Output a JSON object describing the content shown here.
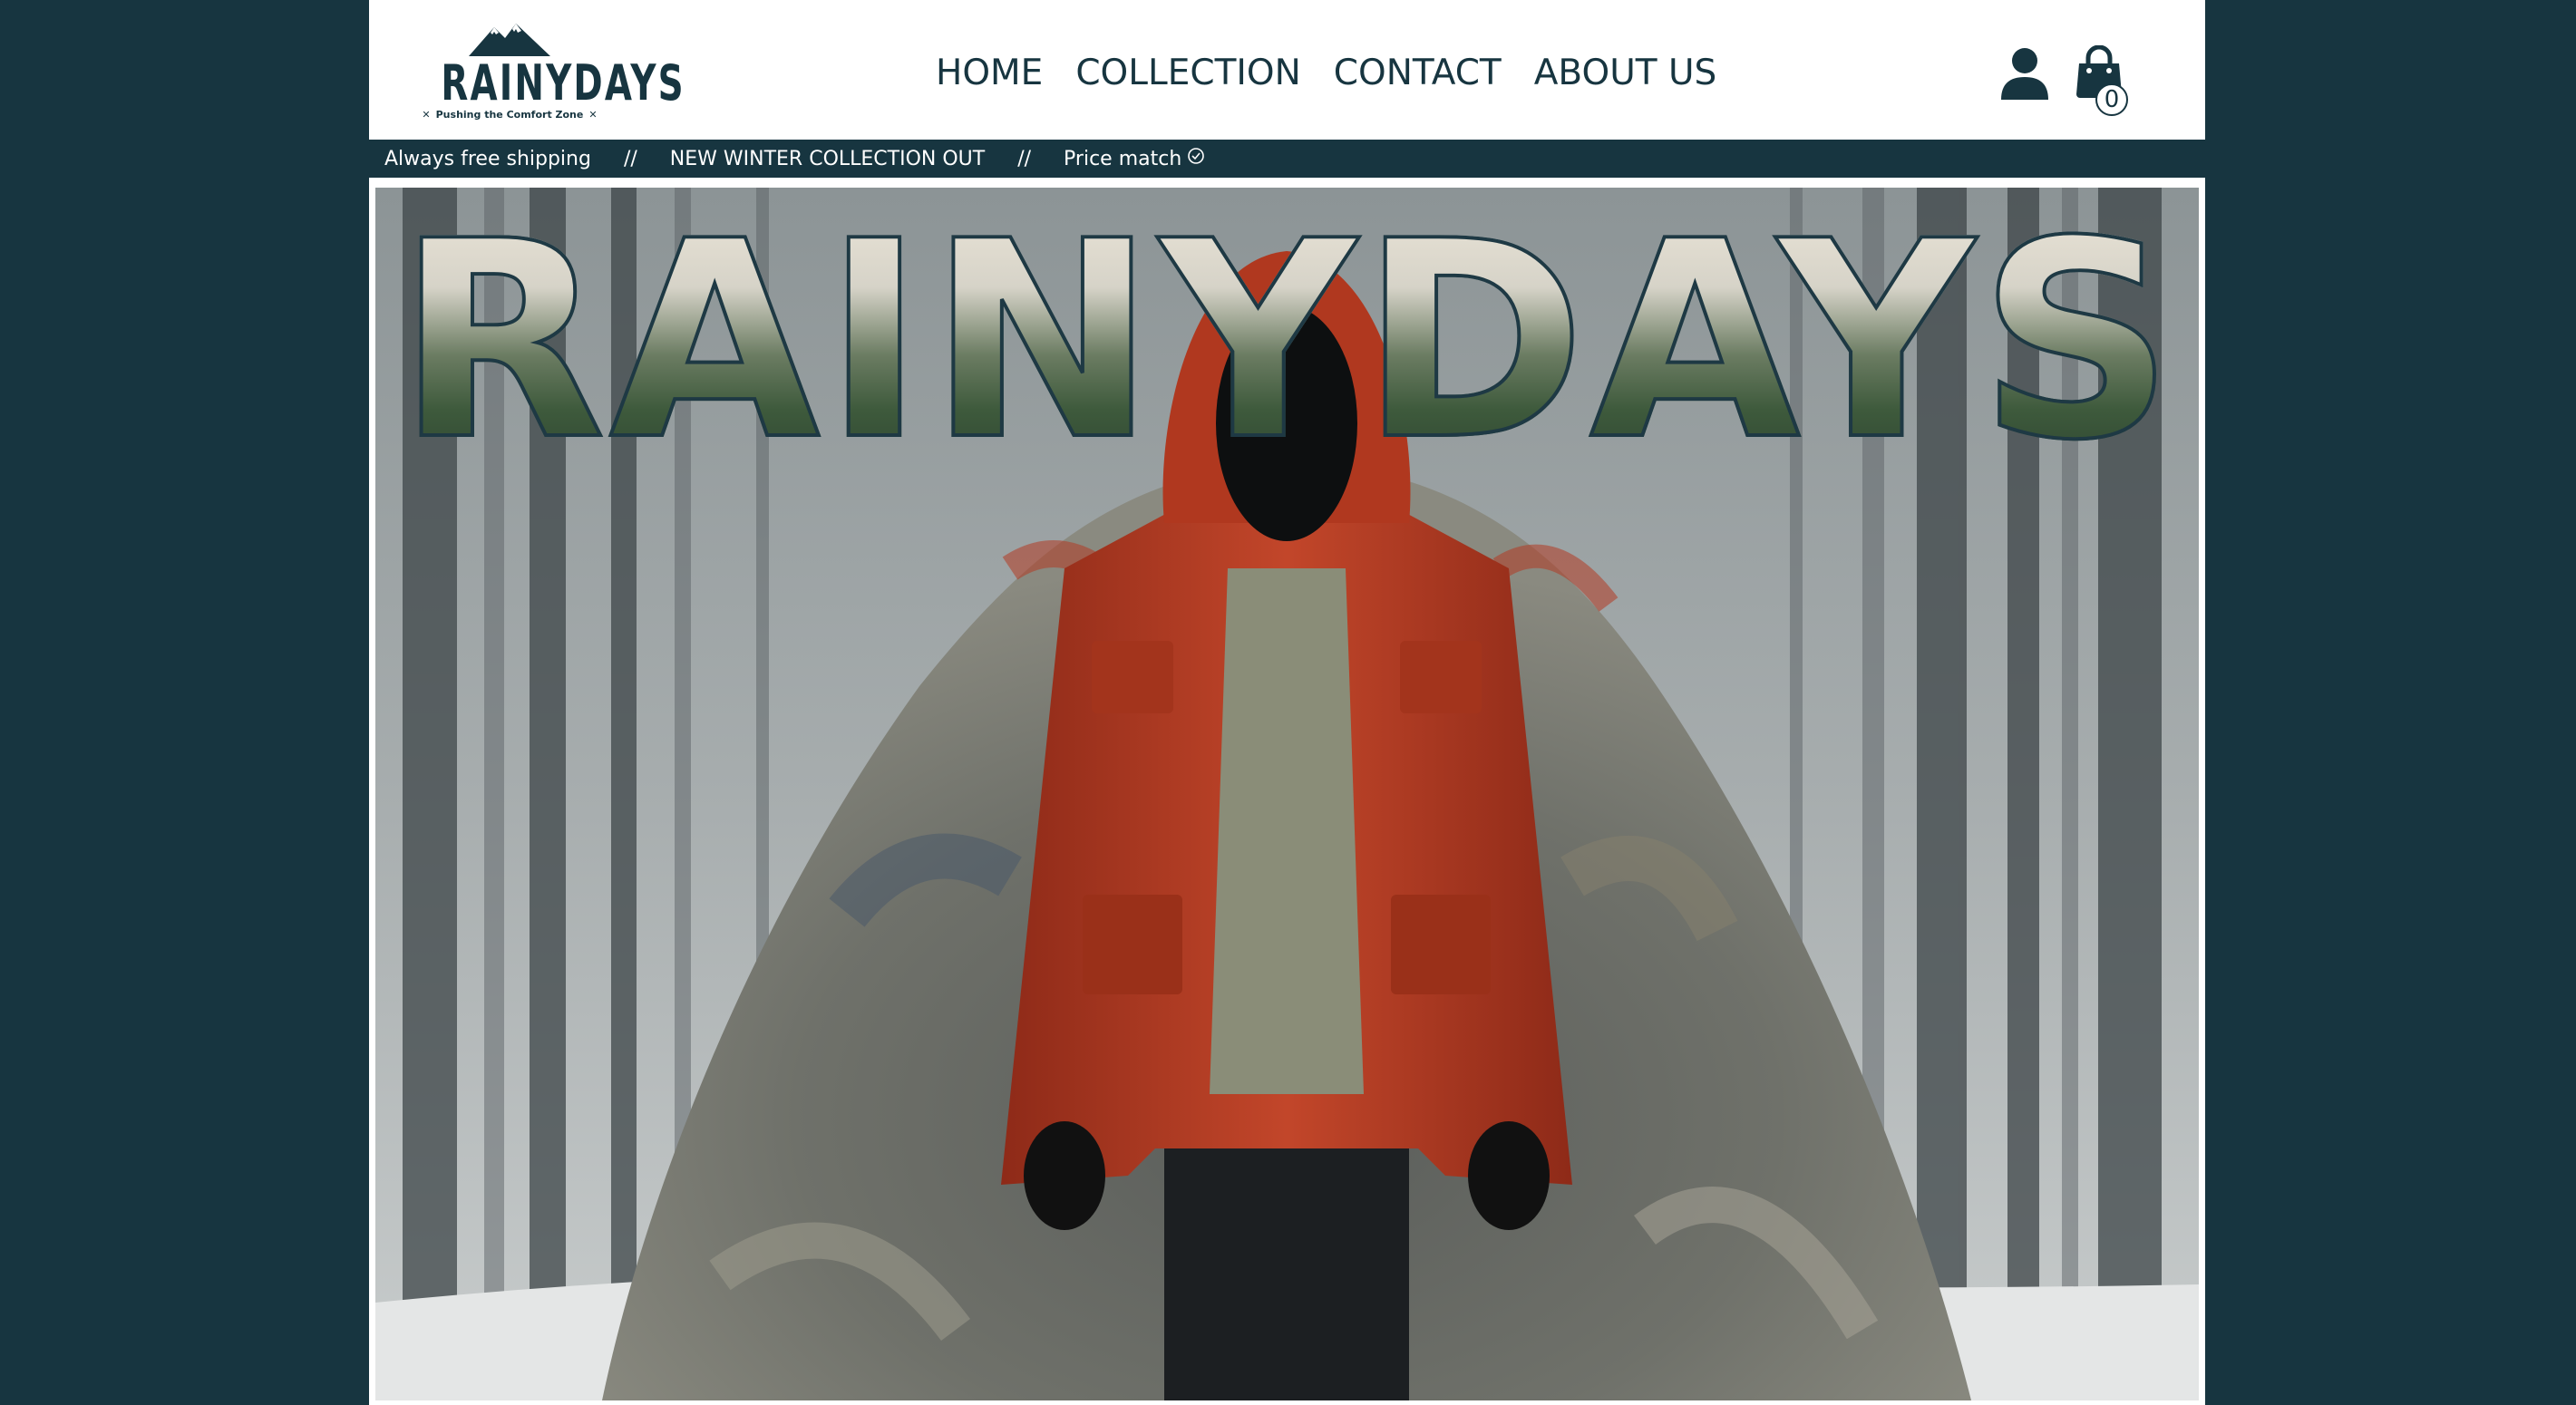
{
  "brand": {
    "logo_word": "RAINYDAYS",
    "tagline": "Pushing the Comfort Zone",
    "tagline_mark": "✕",
    "colors": {
      "dark": "#173540",
      "white": "#ffffff",
      "jacket": "#b33a22"
    }
  },
  "nav": {
    "items": [
      {
        "label": "HOME"
      },
      {
        "label": "COLLECTION"
      },
      {
        "label": "CONTACT"
      },
      {
        "label": "ABOUT US"
      }
    ]
  },
  "header_icons": {
    "user_icon": "user-icon",
    "cart_icon": "shopping-bag-icon",
    "cart_count": "0"
  },
  "infobar": {
    "shipping": "Always free shipping",
    "separator": "//",
    "collection": "NEW WINTER COLLECTION OUT",
    "price_match": "Price match",
    "price_match_icon": "check-circle-icon"
  },
  "hero": {
    "title": "RAINYDAYS",
    "image_subject": "red hooded jacket in front of clothing pile in foggy forest"
  }
}
